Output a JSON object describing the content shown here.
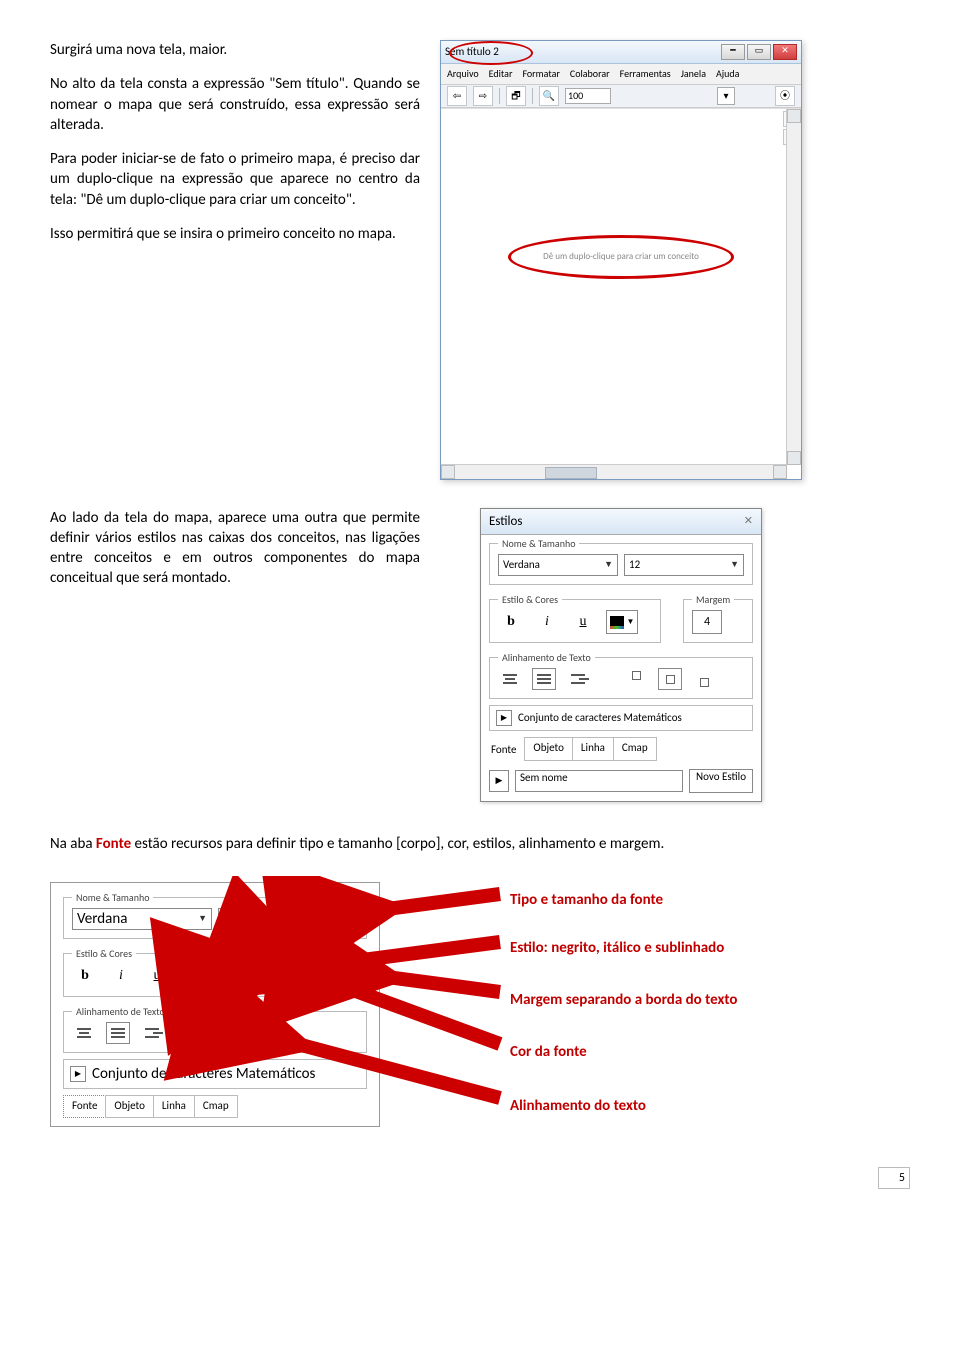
{
  "para1": "Surgirá uma nova tela, maior.",
  "para2": "No alto da tela consta a expressão \"Sem título\". Quando se nomear o mapa que será construído, essa expressão será alterada.",
  "para3": "Para poder iniciar-se de fato o primeiro mapa, é preciso dar um duplo-clique na expressão que aparece no centro da tela: \"Dê um duplo-clique para criar um conceito\".",
  "para4": "Isso permitirá que se insira o primeiro conceito no mapa.",
  "para5": "Ao lado da tela do mapa, aparece uma outra que permite definir vários estilos nas caixas dos conceitos, nas ligações entre conceitos e em outros componentes do mapa conceitual que será montado.",
  "sentence_prefix": "Na aba ",
  "sentence_fonte": "Fonte",
  "sentence_suffix": " estão recursos para definir tipo e tamanho [corpo], cor, estilos, alinhamento e margem.",
  "cmap": {
    "title": "Sem título 2",
    "menus": [
      "Arquivo",
      "Editar",
      "Formatar",
      "Colaborar",
      "Ferramentas",
      "Janela",
      "Ajuda"
    ],
    "zoom": "100",
    "canvas_hint": "Dê um duplo-clique para criar um conceito"
  },
  "estilos": {
    "title": "Estilos",
    "nome_tamanho_legend": "Nome & Tamanho",
    "font_name": "Verdana",
    "font_size": "12",
    "estilo_cores_legend": "Estilo & Cores",
    "margem_legend": "Margem",
    "margem_value": "4",
    "alinhamento_legend": "Alinhamento de Texto",
    "math_label": "Conjunto de caracteres Matemáticos",
    "tabs": [
      "Objeto",
      "Linha",
      "Cmap"
    ],
    "fonte_label": "Fonte",
    "bottom_input": "Sem nome",
    "bottom_btn": "Novo Estilo",
    "bold_glyph": "b",
    "italic_glyph": "i",
    "underline_glyph": "u"
  },
  "ann": {
    "l1": "Tipo e tamanho da fonte",
    "l2": "Estilo: negrito, itálico e sublinhado",
    "l3": "Margem separando a borda do texto",
    "l4": "Cor da fonte",
    "l5": "Alinhamento do texto"
  },
  "page_number": "5"
}
